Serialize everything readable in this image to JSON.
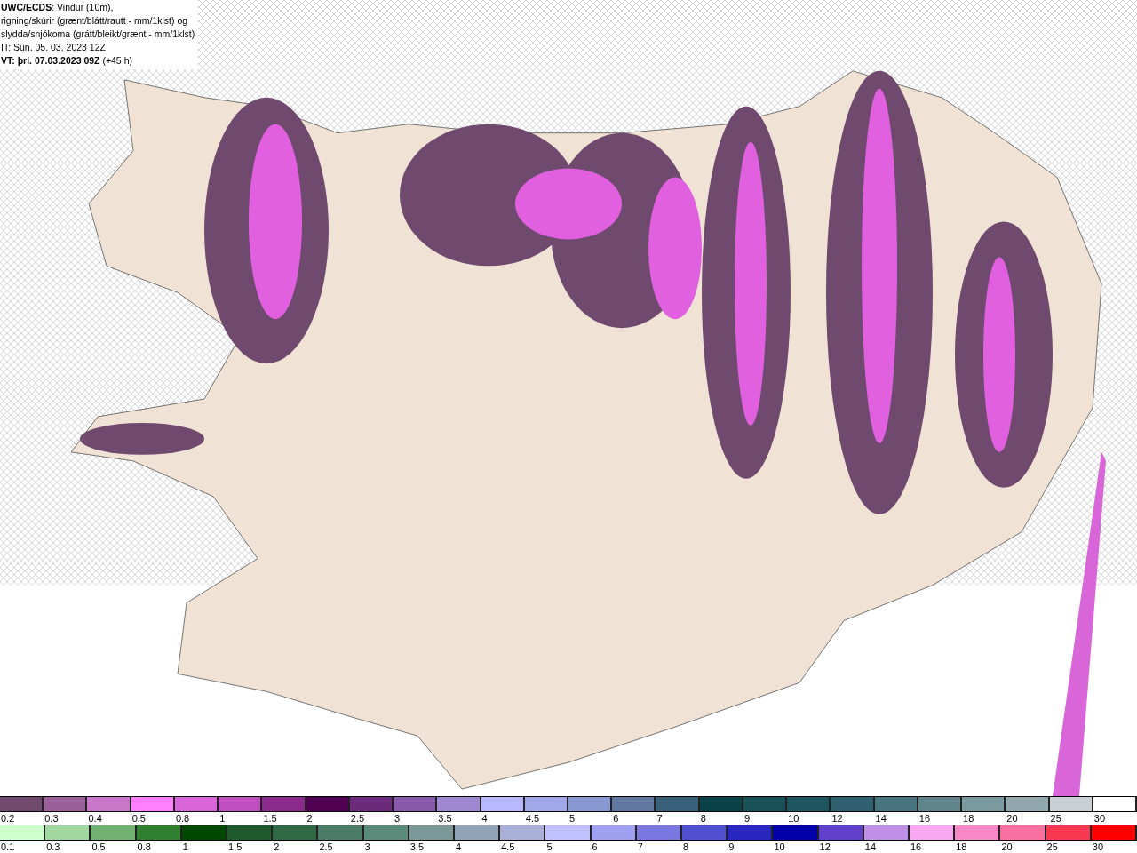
{
  "header": {
    "lines": [
      "**UWC/ECDS**: Vindur (10m),",
      "rigning/skúrir (grænt/blátt/rautt - mm/1klst) og",
      "slydda/snjókoma (grátt/bleikt/grænt - mm/1klst)",
      "IT: Sun. 05. 03. 2023 12Z",
      "**VT: þri. 07.03.2023 09Z** (+45 h)"
    ]
  },
  "legends": [
    {
      "items": [
        {
          "label": "0.2",
          "color": "#6f4a6e"
        },
        {
          "label": "0.3",
          "color": "#9a6099"
        },
        {
          "label": "0.4",
          "color": "#c876c8"
        },
        {
          "label": "0.5",
          "color": "#ff80ff"
        },
        {
          "label": "0.8",
          "color": "#d966d9"
        },
        {
          "label": "1",
          "color": "#c04fc0"
        },
        {
          "label": "1.5",
          "color": "#8a2a8a"
        },
        {
          "label": "2",
          "color": "#4f0050"
        },
        {
          "label": "2.5",
          "color": "#6b2a7a"
        },
        {
          "label": "3",
          "color": "#8a5aaa"
        },
        {
          "label": "3.5",
          "color": "#a088d0"
        },
        {
          "label": "4",
          "color": "#b8b8ff"
        },
        {
          "label": "4.5",
          "color": "#a0a8e8"
        },
        {
          "label": "5",
          "color": "#8898d0"
        },
        {
          "label": "6",
          "color": "#6078a0"
        },
        {
          "label": "7",
          "color": "#38607a"
        },
        {
          "label": "8",
          "color": "#0a4048"
        },
        {
          "label": "9",
          "color": "#1a5058"
        },
        {
          "label": "10",
          "color": "#1e5560"
        },
        {
          "label": "12",
          "color": "#306070"
        },
        {
          "label": "14",
          "color": "#487480"
        },
        {
          "label": "16",
          "color": "#60848c"
        },
        {
          "label": "18",
          "color": "#7a9aa0"
        },
        {
          "label": "20",
          "color": "#90a8ae"
        },
        {
          "label": "25",
          "color": "#c8d0d4"
        },
        {
          "label": "30",
          "color": "#ffffff"
        }
      ]
    },
    {
      "items": [
        {
          "label": "0.1",
          "color": "#ccffcc"
        },
        {
          "label": "0.3",
          "color": "#a0d8a0"
        },
        {
          "label": "0.5",
          "color": "#70b070"
        },
        {
          "label": "0.8",
          "color": "#308030"
        },
        {
          "label": "1",
          "color": "#004800"
        },
        {
          "label": "1.5",
          "color": "#1e5a2a"
        },
        {
          "label": "2",
          "color": "#306a44"
        },
        {
          "label": "2.5",
          "color": "#4a7c68"
        },
        {
          "label": "3",
          "color": "#5a8a7a"
        },
        {
          "label": "3.5",
          "color": "#7a9898"
        },
        {
          "label": "4",
          "color": "#90a4b8"
        },
        {
          "label": "4.5",
          "color": "#a8b0d8"
        },
        {
          "label": "5",
          "color": "#c0c0ff"
        },
        {
          "label": "6",
          "color": "#a0a0f0"
        },
        {
          "label": "7",
          "color": "#7878e0"
        },
        {
          "label": "8",
          "color": "#5050d0"
        },
        {
          "label": "9",
          "color": "#2828c0"
        },
        {
          "label": "10",
          "color": "#0000a8"
        },
        {
          "label": "12",
          "color": "#6040c8"
        },
        {
          "label": "14",
          "color": "#c090e8"
        },
        {
          "label": "16",
          "color": "#f8a8f0"
        },
        {
          "label": "18",
          "color": "#f888c8"
        },
        {
          "label": "20",
          "color": "#f870a0"
        },
        {
          "label": "25",
          "color": "#f83850"
        },
        {
          "label": "30",
          "color": "#ff0000"
        }
      ]
    }
  ]
}
